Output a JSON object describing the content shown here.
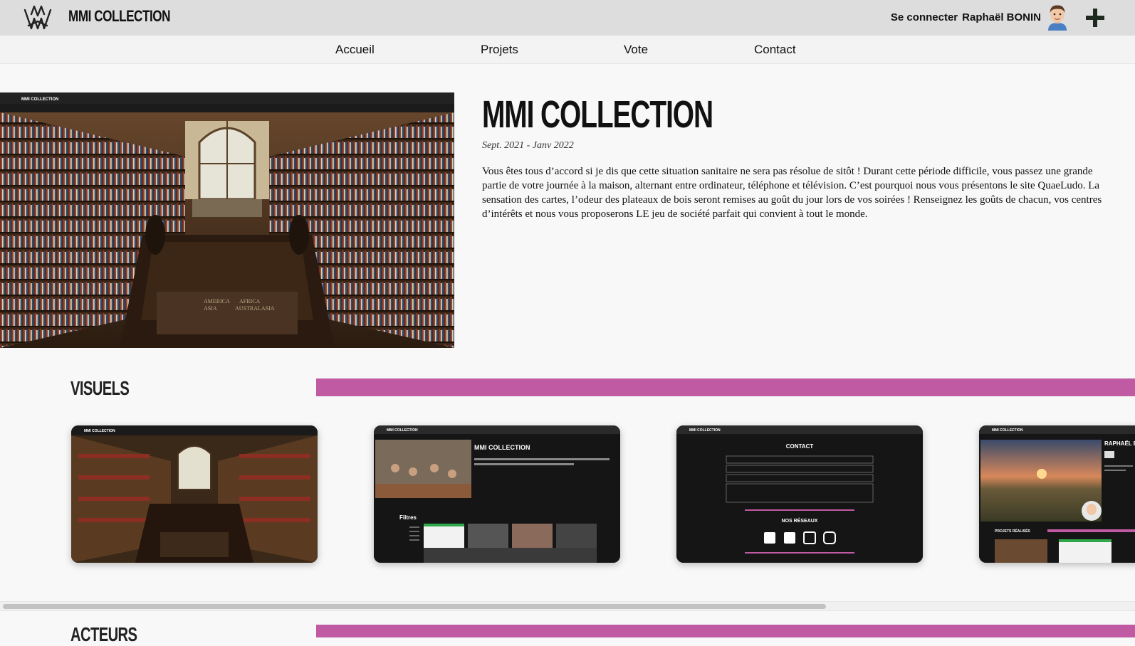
{
  "header": {
    "brand": "MMI COLLECTION",
    "login_label": "Se connecter",
    "user_name": "Raphaël BONIN",
    "add_icon": "plus-icon",
    "logo_icon": "crown-logo-icon"
  },
  "nav": {
    "items": [
      {
        "label": "Accueil"
      },
      {
        "label": "Projets"
      },
      {
        "label": "Vote"
      },
      {
        "label": "Contact"
      }
    ]
  },
  "project": {
    "title": "MMI COLLECTION",
    "dates": "Sept. 2021 - Janv 2022",
    "description": "Vous êtes tous d’accord si je dis que cette situation sanitaire ne sera pas résolue de sitôt ! Durant cette période difficile, vous passez une grande partie de votre journée à la maison, alternant entre ordinateur, téléphone et télévision. C’est pourquoi nous vous présentons le site QuaeLudo. La sensation des cartes, l’odeur des plateaux de bois seront remises au goût du jour lors de vos soirées ! Renseignez les goûts de chacun, vos centres d’intérêts et nous vous proposerons LE jeu de société parfait qui convient à tout le monde."
  },
  "sections": {
    "visuels_title": "VISUELS",
    "acteurs_title": "ACTEURS"
  },
  "colors": {
    "accent": "#c05aa2",
    "topbar": "#dddddd",
    "navbar": "#f3f3f3"
  },
  "thumbnails": {
    "t1": {
      "mini_brand": "MMI COLLECTION"
    },
    "t2": {
      "mini_brand": "MMI COLLECTION",
      "heading": "MMI COLLECTION",
      "filters": "Filtres"
    },
    "t3": {
      "mini_brand": "MMI COLLECTION",
      "heading": "CONTACT",
      "social_heading": "NOS RÉSEAUX"
    },
    "t4": {
      "mini_brand": "MMI COLLECTION",
      "name": "RAPHAËL BONI",
      "projects": "PROJETS RÉALISÉS"
    }
  }
}
